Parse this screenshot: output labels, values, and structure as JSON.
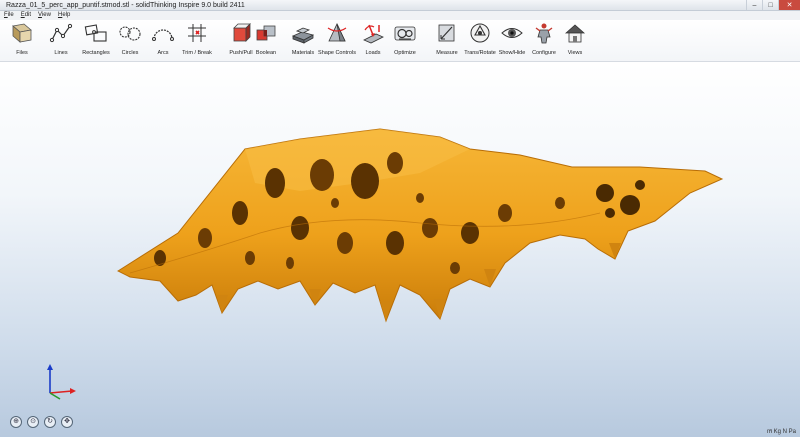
{
  "window": {
    "title": "Razza_01_5_perc_app_puntif.stmod.stl - solidThinking Inspire 9.0 build 2411",
    "minimize": "–",
    "maximize": "□",
    "close": "✕"
  },
  "menu": [
    "File",
    "Edit",
    "View",
    "Help"
  ],
  "toolbar": {
    "items": [
      {
        "label": "Files",
        "icon": "files-icon"
      },
      {
        "label": "Lines",
        "icon": "lines-icon"
      },
      {
        "label": "Rectangles",
        "icon": "rectangles-icon"
      },
      {
        "label": "Circles",
        "icon": "circles-icon"
      },
      {
        "label": "Arcs",
        "icon": "arcs-icon"
      },
      {
        "label": "Trim / Break",
        "icon": "trim-break-icon"
      },
      {
        "label": "Push/Pull",
        "icon": "push-pull-icon"
      },
      {
        "label": "Boolean",
        "icon": "boolean-icon"
      },
      {
        "label": "Materials",
        "icon": "materials-icon"
      },
      {
        "label": "Shape Controls",
        "icon": "shape-controls-icon"
      },
      {
        "label": "Loads",
        "icon": "loads-icon"
      },
      {
        "label": "Optimize",
        "icon": "optimize-icon"
      },
      {
        "label": "Measure",
        "icon": "measure-icon"
      },
      {
        "label": "Trans/Rotate",
        "icon": "trans-rotate-icon"
      },
      {
        "label": "Show/Hide",
        "icon": "show-hide-icon"
      },
      {
        "label": "Configure",
        "icon": "configure-icon"
      },
      {
        "label": "Views",
        "icon": "views-icon"
      }
    ]
  },
  "status": {
    "units": "m Kg N Pa",
    "scroll_indicator": "‹"
  },
  "colors": {
    "model": "#f0a21a",
    "model_shadow": "#b86d06",
    "background_top": "#ffffff",
    "background_bottom": "#b7c9de"
  }
}
